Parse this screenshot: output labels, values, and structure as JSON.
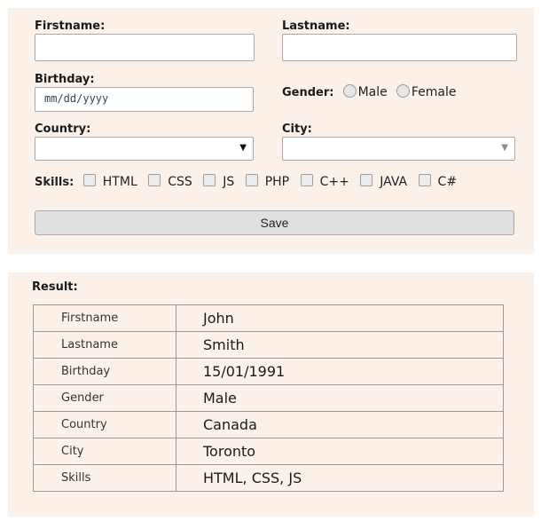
{
  "form": {
    "firstname_label": "Firstname:",
    "firstname_value": "",
    "lastname_label": "Lastname:",
    "lastname_value": "",
    "birthday_label": "Birthday:",
    "birthday_placeholder": "mm/dd/yyyy",
    "gender_label": "Gender:",
    "gender_options": [
      "Male",
      "Female"
    ],
    "country_label": "Country:",
    "country_value": "",
    "city_label": "City:",
    "city_value": "",
    "skills_label": "Skills:",
    "skills": [
      "HTML",
      "CSS",
      "JS",
      "PHP",
      "C++",
      "JAVA",
      "C#"
    ],
    "save_label": "Save"
  },
  "result": {
    "title": "Result:",
    "rows": [
      {
        "key": "Firstname",
        "value": "John"
      },
      {
        "key": "Lastname",
        "value": "Smith"
      },
      {
        "key": "Birthday",
        "value": "15/01/1991"
      },
      {
        "key": "Gender",
        "value": "Male"
      },
      {
        "key": "Country",
        "value": "Canada"
      },
      {
        "key": "City",
        "value": "Toronto"
      },
      {
        "key": "Skills",
        "value": "HTML, CSS, JS"
      }
    ]
  },
  "colors": {
    "panel_background": "#fbf1e9",
    "button_background": "#e0e0e0",
    "border": "#a9a9a9"
  }
}
